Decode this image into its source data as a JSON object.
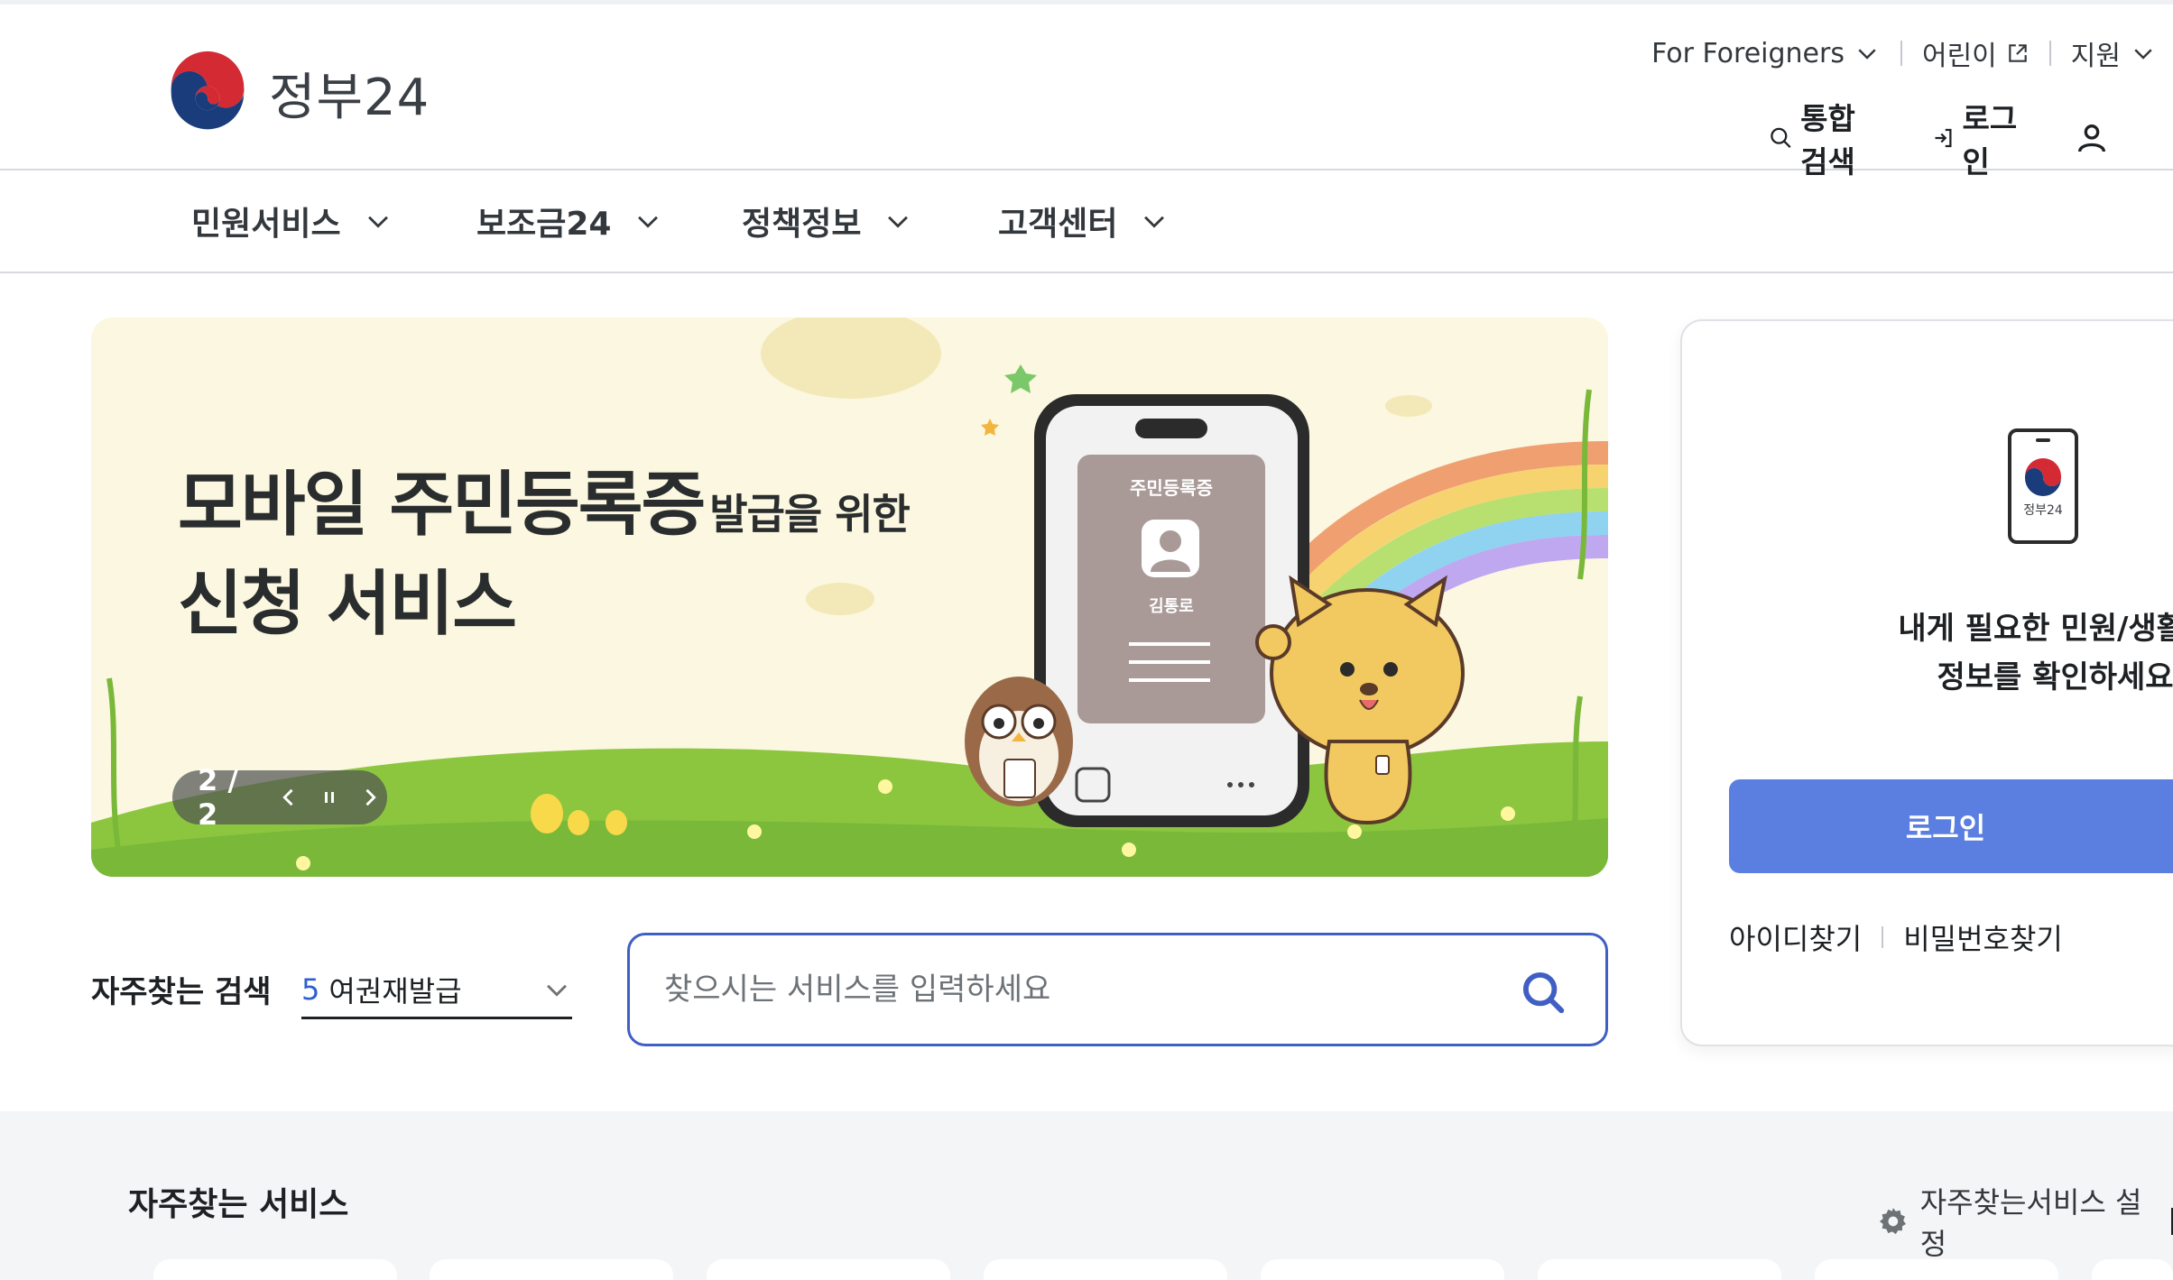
{
  "header": {
    "logo_text": "정부24",
    "util_links": [
      {
        "label": "For Foreigners",
        "icon": "chevron-down-icon"
      },
      {
        "label": "어린이",
        "icon": "external-link-icon"
      },
      {
        "label": "지원",
        "icon": "chevron-down-icon"
      }
    ],
    "actions": {
      "search_label": "통합검색",
      "login_label": "로그인"
    }
  },
  "gnb": {
    "items": [
      {
        "label": "민원서비스"
      },
      {
        "label": "보조금24"
      },
      {
        "label": "정책정보"
      },
      {
        "label": "고객센터"
      }
    ]
  },
  "banner": {
    "title_line1": "모바일 주민등록증",
    "title_small": "발급을 위한",
    "title_line2": "신청 서비스",
    "card_title": "주민등록증",
    "card_name": "김통로",
    "pager_text": "2 / 2"
  },
  "search": {
    "fav_label": "자주찾는 검색",
    "fav_rank": "5",
    "fav_term": "여권재발급",
    "placeholder": "찾으시는 서비스를 입력하세요"
  },
  "login_panel": {
    "icon_text": "정부24",
    "message_line1": "내게 필요한 민원/생활/혜",
    "message_line2": "정보를 확인하세요.",
    "login_button": "로그인",
    "find_id": "아이디찾기",
    "find_password": "비밀번호찾기"
  },
  "frequent_services": {
    "title": "자주찾는 서비스",
    "setting_label": "자주찾는서비스 설정"
  },
  "colors": {
    "brand_blue": "#3f5fc4",
    "login_button": "#5b7fe0",
    "accent_number": "#2d5fd1"
  }
}
